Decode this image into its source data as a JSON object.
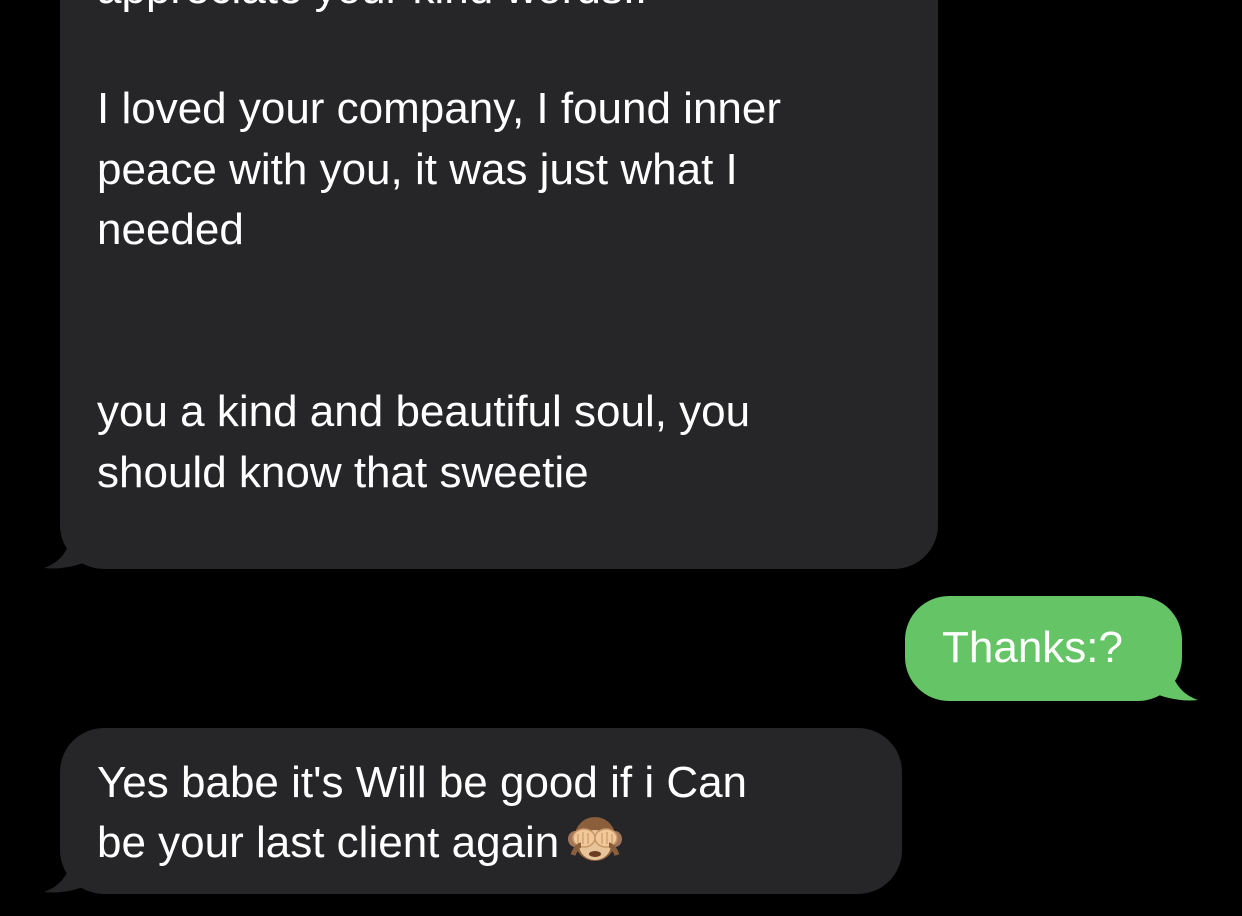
{
  "conversation": {
    "messages": [
      {
        "direction": "incoming",
        "lines": [
          "appreciate your kind words!!",
          "I loved your company, I found inner",
          "peace with you, it was just what I",
          "needed",
          "you a kind and beautiful soul, you",
          "should know that sweetie"
        ]
      },
      {
        "direction": "outgoing",
        "lines": [
          "Thanks:?"
        ]
      },
      {
        "direction": "incoming",
        "lines": [
          "Yes babe it's Will be good if i Can",
          "be your last client again"
        ],
        "emoji": "see-no-evil-monkey-icon"
      }
    ]
  },
  "colors": {
    "background": "#000000",
    "incoming_bubble": "#262628",
    "outgoing_bubble": "#65c466",
    "text": "#ffffff"
  }
}
